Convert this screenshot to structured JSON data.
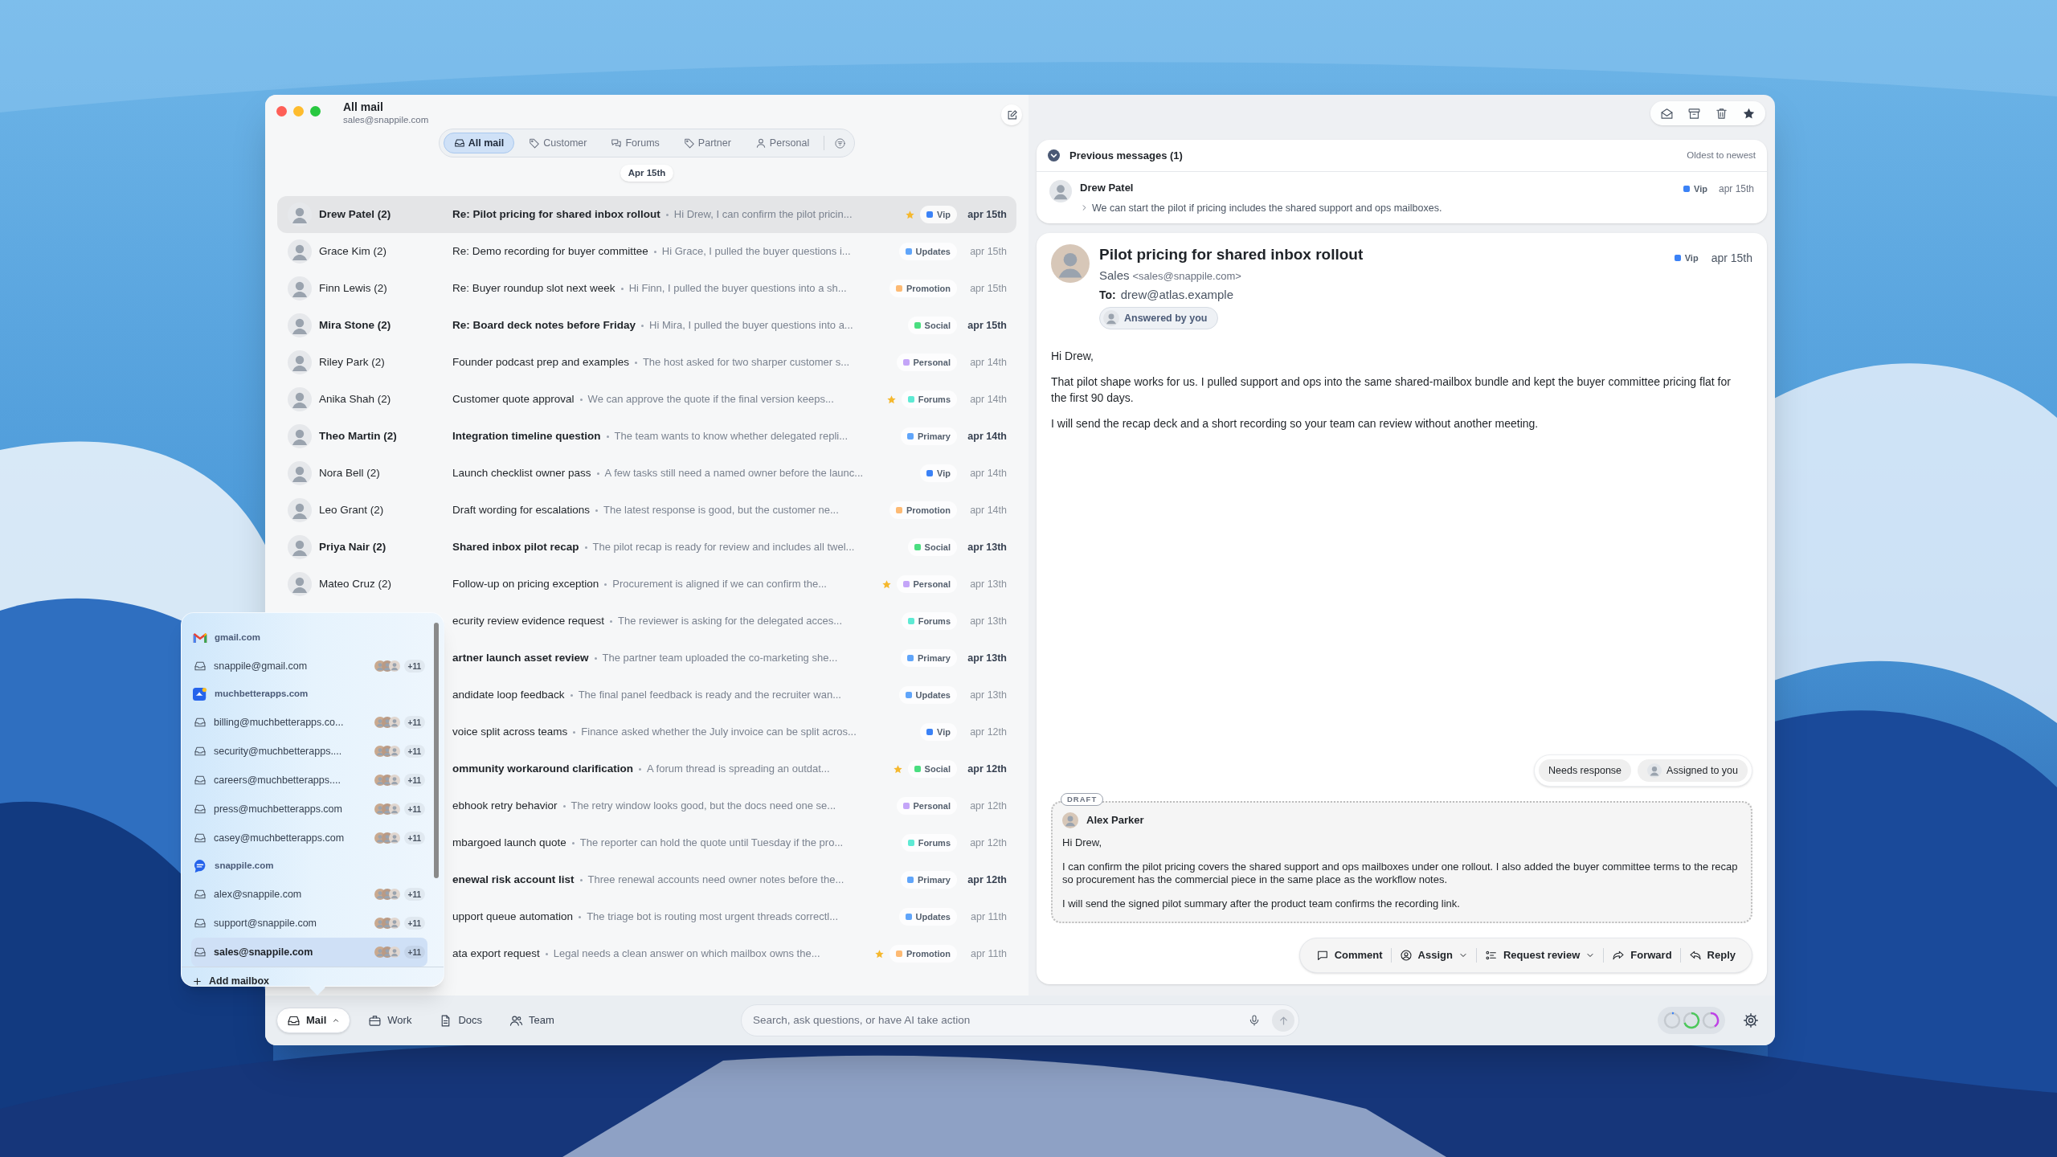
{
  "window": {
    "title": "All mail",
    "subtitle": "sales@snappile.com"
  },
  "filter_tabs": [
    {
      "label": "All mail",
      "kind": "inbox",
      "selected": true
    },
    {
      "label": "Customer",
      "kind": "tag",
      "selected": false
    },
    {
      "label": "Forums",
      "kind": "chat",
      "selected": false
    },
    {
      "label": "Partner",
      "kind": "tag",
      "selected": false
    },
    {
      "label": "Personal",
      "kind": "person",
      "selected": false
    }
  ],
  "date_chip": "Apr 15th",
  "messages": [
    {
      "sender": "Drew Patel (2)",
      "subject": "Re: Pilot pricing for shared inbox rollout",
      "preview": "Hi Drew, I can confirm the pilot pricin...",
      "starred": true,
      "tag": {
        "label": "Vip",
        "color": "#3b82f6"
      },
      "date": "apr 15th",
      "unread": true,
      "selected": true
    },
    {
      "sender": "Grace Kim (2)",
      "subject": "Re: Demo recording for buyer committee",
      "preview": "Hi Grace, I pulled the buyer questions i...",
      "starred": false,
      "tag": {
        "label": "Updates",
        "color": "#60a5fa"
      },
      "date": "apr 15th",
      "unread": false,
      "selected": false
    },
    {
      "sender": "Finn Lewis (2)",
      "subject": "Re: Buyer roundup slot next week",
      "preview": "Hi Finn, I pulled the buyer questions into a sh...",
      "starred": false,
      "tag": {
        "label": "Promotion",
        "color": "#fdba74"
      },
      "date": "apr 15th",
      "unread": false,
      "selected": false
    },
    {
      "sender": "Mira Stone (2)",
      "subject": "Re: Board deck notes before Friday",
      "preview": "Hi Mira, I pulled the buyer questions into a...",
      "starred": false,
      "tag": {
        "label": "Social",
        "color": "#4ade80"
      },
      "date": "apr 15th",
      "unread": true,
      "selected": false
    },
    {
      "sender": "Riley Park (2)",
      "subject": "Founder podcast prep and examples",
      "preview": "The host asked for two sharper customer s...",
      "starred": false,
      "tag": {
        "label": "Personal",
        "color": "#c4a5f8"
      },
      "date": "apr 14th",
      "unread": false,
      "selected": false
    },
    {
      "sender": "Anika Shah (2)",
      "subject": "Customer quote approval",
      "preview": "We can approve the quote if the final version keeps...",
      "starred": true,
      "tag": {
        "label": "Forums",
        "color": "#5eead4"
      },
      "date": "apr 14th",
      "unread": false,
      "selected": false
    },
    {
      "sender": "Theo Martin (2)",
      "subject": "Integration timeline question",
      "preview": "The team wants to know whether delegated repli...",
      "starred": false,
      "tag": {
        "label": "Primary",
        "color": "#60a5fa"
      },
      "date": "apr 14th",
      "unread": true,
      "selected": false
    },
    {
      "sender": "Nora Bell (2)",
      "subject": "Launch checklist owner pass",
      "preview": "A few tasks still need a named owner before the launc...",
      "starred": false,
      "tag": {
        "label": "Vip",
        "color": "#3b82f6"
      },
      "date": "apr 14th",
      "unread": false,
      "selected": false
    },
    {
      "sender": "Leo Grant (2)",
      "subject": "Draft wording for escalations",
      "preview": "The latest response is good, but the customer ne...",
      "starred": false,
      "tag": {
        "label": "Promotion",
        "color": "#fdba74"
      },
      "date": "apr 14th",
      "unread": false,
      "selected": false
    },
    {
      "sender": "Priya Nair (2)",
      "subject": "Shared inbox pilot recap",
      "preview": "The pilot recap is ready for review and includes all twel...",
      "starred": false,
      "tag": {
        "label": "Social",
        "color": "#4ade80"
      },
      "date": "apr 13th",
      "unread": true,
      "selected": false
    },
    {
      "sender": "Mateo Cruz (2)",
      "subject": "Follow-up on pricing exception",
      "preview": "Procurement is aligned if we can confirm the...",
      "starred": true,
      "tag": {
        "label": "Personal",
        "color": "#c4a5f8"
      },
      "date": "apr 13th",
      "unread": false,
      "selected": false
    },
    {
      "subject": "ecurity review evidence request",
      "preview": "The reviewer is asking for the delegated acces...",
      "starred": false,
      "tag": {
        "label": "Forums",
        "color": "#5eead4"
      },
      "date": "apr 13th",
      "unread": false,
      "selected": false
    },
    {
      "subject": "artner launch asset review",
      "preview": "The partner team uploaded the co-marketing she...",
      "starred": false,
      "tag": {
        "label": "Primary",
        "color": "#60a5fa"
      },
      "date": "apr 13th",
      "unread": true,
      "selected": false
    },
    {
      "subject": "andidate loop feedback",
      "preview": "The final panel feedback is ready and the recruiter wan...",
      "starred": false,
      "tag": {
        "label": "Updates",
        "color": "#60a5fa"
      },
      "date": "apr 13th",
      "unread": false,
      "selected": false
    },
    {
      "subject": "voice split across teams",
      "preview": "Finance asked whether the July invoice can be split acros...",
      "starred": false,
      "tag": {
        "label": "Vip",
        "color": "#3b82f6"
      },
      "date": "apr 12th",
      "unread": false,
      "selected": false
    },
    {
      "subject": "ommunity workaround clarification",
      "preview": "A forum thread is spreading an outdat...",
      "starred": true,
      "tag": {
        "label": "Social",
        "color": "#4ade80"
      },
      "date": "apr 12th",
      "unread": true,
      "selected": false
    },
    {
      "subject": "ebhook retry behavior",
      "preview": "The retry window looks good, but the docs need one se...",
      "starred": false,
      "tag": {
        "label": "Personal",
        "color": "#c4a5f8"
      },
      "date": "apr 12th",
      "unread": false,
      "selected": false
    },
    {
      "subject": "mbargoed launch quote",
      "preview": "The reporter can hold the quote until Tuesday if the pro...",
      "starred": false,
      "tag": {
        "label": "Forums",
        "color": "#5eead4"
      },
      "date": "apr 12th",
      "unread": false,
      "selected": false
    },
    {
      "subject": "enewal risk account list",
      "preview": "Three renewal accounts need owner notes before the...",
      "starred": false,
      "tag": {
        "label": "Primary",
        "color": "#60a5fa"
      },
      "date": "apr 12th",
      "unread": true,
      "selected": false
    },
    {
      "subject": "upport queue automation",
      "preview": "The triage bot is routing most urgent threads correctl...",
      "starred": false,
      "tag": {
        "label": "Updates",
        "color": "#60a5fa"
      },
      "date": "apr 11th",
      "unread": false,
      "selected": false
    },
    {
      "subject": "ata export request",
      "preview": "Legal needs a clean answer on which mailbox owns the...",
      "starred": true,
      "tag": {
        "label": "Promotion",
        "color": "#fdba74"
      },
      "date": "apr 11th",
      "unread": false,
      "selected": false
    }
  ],
  "mailbox_menu": {
    "groups": [
      {
        "domain": "gmail.com",
        "kind": "gmail",
        "mailboxes": [
          {
            "address": "snappile@gmail.com",
            "count": "+11",
            "selected": false
          }
        ]
      },
      {
        "domain": "muchbetterapps.com",
        "kind": "app",
        "mailboxes": [
          {
            "address": "billing@muchbetterapps.co...",
            "count": "+11",
            "selected": false
          },
          {
            "address": "security@muchbetterapps....",
            "count": "+11",
            "selected": false
          },
          {
            "address": "careers@muchbetterapps....",
            "count": "+11",
            "selected": false
          },
          {
            "address": "press@muchbetterapps.com",
            "count": "+11",
            "selected": false
          },
          {
            "address": "casey@muchbetterapps.com",
            "count": "+11",
            "selected": false
          }
        ]
      },
      {
        "domain": "snappile.com",
        "kind": "chat",
        "mailboxes": [
          {
            "address": "alex@snappile.com",
            "count": "+11",
            "selected": false
          },
          {
            "address": "support@snappile.com",
            "count": "+11",
            "selected": false
          },
          {
            "address": "sales@snappile.com",
            "count": "+11",
            "selected": true
          }
        ]
      }
    ],
    "add_label": "Add mailbox"
  },
  "previous_messages": {
    "title": "Previous messages (1)",
    "sort": "Oldest to newest",
    "items": [
      {
        "sender": "Drew Patel",
        "snippet": "We can start the pilot if pricing includes the shared support and ops mailboxes.",
        "tag": {
          "label": "Vip",
          "color": "#3b82f6"
        },
        "date": "apr 15th"
      }
    ]
  },
  "message": {
    "subject": "Pilot pricing for shared inbox rollout",
    "from_name": "Sales",
    "from_address": "<sales@snappile.com>",
    "to_label": "To:",
    "to": "drew@atlas.example",
    "status_chip": "Answered by you",
    "tag": {
      "label": "Vip",
      "color": "#3b82f6"
    },
    "date": "apr 15th",
    "body": [
      "Hi Drew,",
      "That pilot shape works for us. I pulled support and ops into the same shared-mailbox bundle and kept the buyer committee pricing flat for the first 90 days.",
      "I will send the recap deck and a short recording so your team can review without another meeting."
    ]
  },
  "status_chips": [
    {
      "label": "Needs response",
      "kind": "plain"
    },
    {
      "label": "Assigned to you",
      "kind": "avatar"
    }
  ],
  "draft": {
    "badge": "DRAFT",
    "author": "Alex Parker",
    "body": [
      "Hi Drew,",
      "I can confirm the pilot pricing covers the shared support and ops mailboxes under one rollout. I also added the buyer committee terms to the recap so procurement has the commercial piece in the same place as the workflow notes.",
      "I will send the signed pilot summary after the product team confirms the recording link."
    ]
  },
  "actions": [
    {
      "label": "Comment",
      "kind": "comment",
      "dropdown": false
    },
    {
      "label": "Assign",
      "kind": "assign",
      "dropdown": true
    },
    {
      "label": "Request review",
      "kind": "review",
      "dropdown": true
    },
    {
      "label": "Forward",
      "kind": "forward",
      "dropdown": false
    },
    {
      "label": "Reply",
      "kind": "reply",
      "dropdown": false
    }
  ],
  "bottom_nav": [
    {
      "label": "Mail",
      "kind": "mail",
      "selected": true,
      "dropdown": true
    },
    {
      "label": "Work",
      "kind": "work",
      "selected": false,
      "dropdown": false
    },
    {
      "label": "Docs",
      "kind": "docs",
      "selected": false,
      "dropdown": false
    },
    {
      "label": "Team",
      "kind": "team",
      "selected": false,
      "dropdown": false
    }
  ],
  "search": {
    "placeholder": "Search, ask questions, or have AI take action"
  }
}
